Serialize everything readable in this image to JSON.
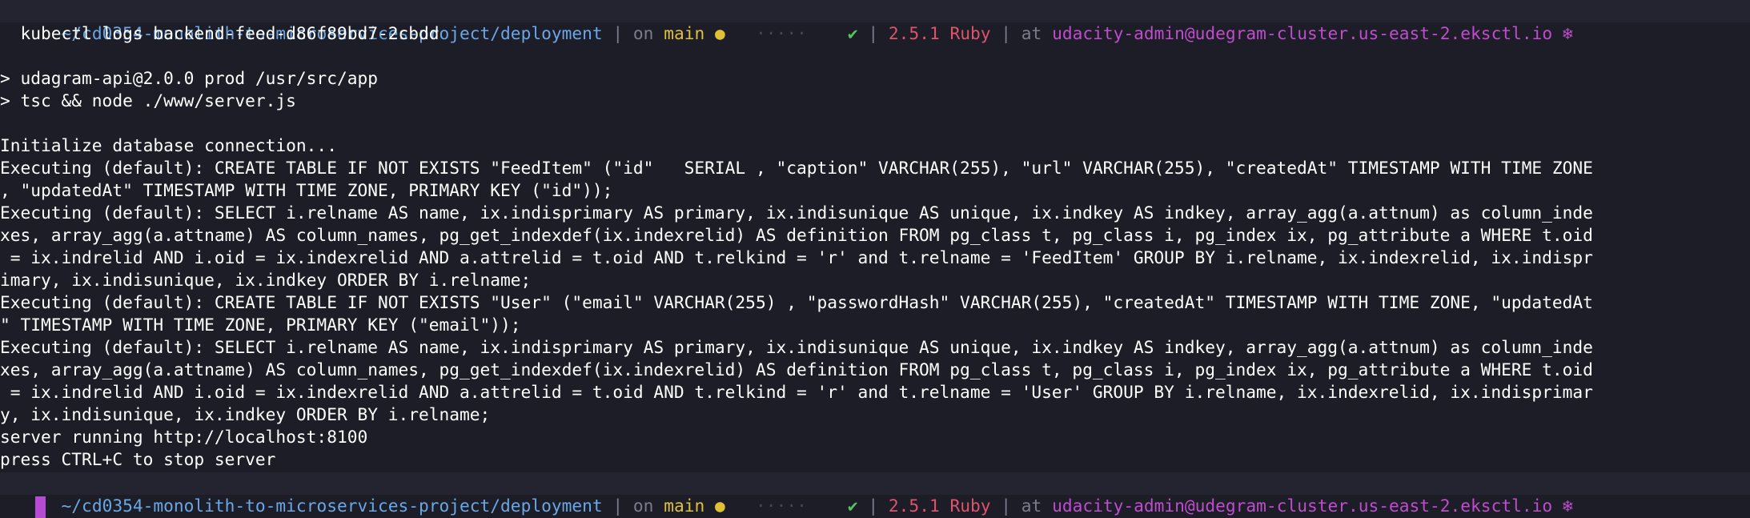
{
  "colors": {
    "background": "#1c1d26",
    "path": "#6aa7e8",
    "branch": "#e0c034",
    "success": "#58c25d",
    "ruby": "#e0536b",
    "context": "#c04ccf",
    "cursor": "#b54bd0"
  },
  "prompt": {
    "path": "~/cd0354-monolith-to-microservices-project/deployment",
    "separator": "|",
    "on_label": "on",
    "branch": "main",
    "dirty_glyph": "●",
    "dots": "·····",
    "success_glyph": "✔",
    "ruby_version": "2.5.1 Ruby",
    "at_label": "at",
    "kube_context": "udacity-admin@udegram-cluster.us-east-2.eksctl.io",
    "kube_icon": "❄"
  },
  "command": "kubectl logs backend-feed-d86f89bd7-2cbdd",
  "output": [
    "",
    "> udagram-api@2.0.0 prod /usr/src/app",
    "> tsc && node ./www/server.js",
    "",
    "Initialize database connection...",
    "Executing (default): CREATE TABLE IF NOT EXISTS \"FeedItem\" (\"id\"   SERIAL , \"caption\" VARCHAR(255), \"url\" VARCHAR(255), \"createdAt\" TIMESTAMP WITH TIME ZONE",
    ", \"updatedAt\" TIMESTAMP WITH TIME ZONE, PRIMARY KEY (\"id\"));",
    "Executing (default): SELECT i.relname AS name, ix.indisprimary AS primary, ix.indisunique AS unique, ix.indkey AS indkey, array_agg(a.attnum) as column_inde",
    "xes, array_agg(a.attname) AS column_names, pg_get_indexdef(ix.indexrelid) AS definition FROM pg_class t, pg_class i, pg_index ix, pg_attribute a WHERE t.oid",
    " = ix.indrelid AND i.oid = ix.indexrelid AND a.attrelid = t.oid AND t.relkind = 'r' and t.relname = 'FeedItem' GROUP BY i.relname, ix.indexrelid, ix.indispr",
    "imary, ix.indisunique, ix.indkey ORDER BY i.relname;",
    "Executing (default): CREATE TABLE IF NOT EXISTS \"User\" (\"email\" VARCHAR(255) , \"passwordHash\" VARCHAR(255), \"createdAt\" TIMESTAMP WITH TIME ZONE, \"updatedAt",
    "\" TIMESTAMP WITH TIME ZONE, PRIMARY KEY (\"email\"));",
    "Executing (default): SELECT i.relname AS name, ix.indisprimary AS primary, ix.indisunique AS unique, ix.indkey AS indkey, array_agg(a.attnum) as column_inde",
    "xes, array_agg(a.attname) AS column_names, pg_get_indexdef(ix.indexrelid) AS definition FROM pg_class t, pg_class i, pg_index ix, pg_attribute a WHERE t.oid",
    " = ix.indrelid AND i.oid = ix.indexrelid AND a.attrelid = t.oid AND t.relkind = 'r' and t.relname = 'User' GROUP BY i.relname, ix.indexrelid, ix.indisprimar",
    "y, ix.indisunique, ix.indkey ORDER BY i.relname;",
    "server running http://localhost:8100",
    "press CTRL+C to stop server"
  ]
}
